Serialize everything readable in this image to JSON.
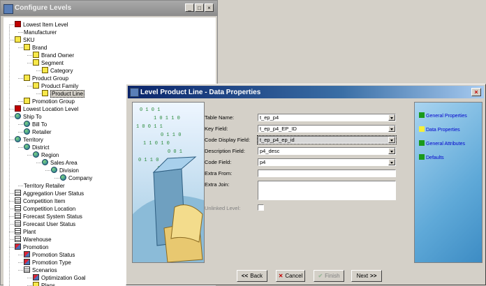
{
  "back_window": {
    "title": "Configure Levels",
    "tree": [
      {
        "label": "Lowest Item Level",
        "icon": "redx",
        "depth": 0
      },
      {
        "label": "Manufacturer",
        "icon": "none",
        "depth": 1
      },
      {
        "label": "SKU",
        "icon": "cube",
        "depth": 0
      },
      {
        "label": "Brand",
        "icon": "cube",
        "depth": 1
      },
      {
        "label": "Brand Owner",
        "icon": "cube",
        "depth": 2
      },
      {
        "label": "Segment",
        "icon": "cube",
        "depth": 2
      },
      {
        "label": "Category",
        "icon": "cube",
        "depth": 3
      },
      {
        "label": "Product Group",
        "icon": "cube",
        "depth": 1
      },
      {
        "label": "Product Family",
        "icon": "cube",
        "depth": 2
      },
      {
        "label": "Product Line",
        "icon": "cube",
        "depth": 3,
        "selected": true
      },
      {
        "label": "Promotion Group",
        "icon": "cube",
        "depth": 1
      },
      {
        "label": "Lowest Location Level",
        "icon": "redx",
        "depth": 0
      },
      {
        "label": "Ship To",
        "icon": "globe",
        "depth": 0
      },
      {
        "label": "Bill To",
        "icon": "globe",
        "depth": 1
      },
      {
        "label": "Retailer",
        "icon": "globe",
        "depth": 1
      },
      {
        "label": "Territory",
        "icon": "globe",
        "depth": 0
      },
      {
        "label": "District",
        "icon": "globe",
        "depth": 1
      },
      {
        "label": "Region",
        "icon": "globe",
        "depth": 2
      },
      {
        "label": "Sales Area",
        "icon": "globe",
        "depth": 3
      },
      {
        "label": "Division",
        "icon": "globe",
        "depth": 4
      },
      {
        "label": "Company",
        "icon": "globe",
        "depth": 5
      },
      {
        "label": "Territory Retailer",
        "icon": "none",
        "depth": 1
      },
      {
        "label": "Aggregation User Status",
        "icon": "table",
        "depth": 0
      },
      {
        "label": "Competition Item",
        "icon": "table",
        "depth": 0
      },
      {
        "label": "Competition Location",
        "icon": "table",
        "depth": 0
      },
      {
        "label": "Forecast System Status",
        "icon": "table",
        "depth": 0
      },
      {
        "label": "Forecast User Status",
        "icon": "table",
        "depth": 0
      },
      {
        "label": "Plant",
        "icon": "table",
        "depth": 0
      },
      {
        "label": "Warehouse",
        "icon": "table",
        "depth": 0
      },
      {
        "label": "Promotion",
        "icon": "promo",
        "depth": 0
      },
      {
        "label": "Promotion Status",
        "icon": "promo",
        "depth": 1
      },
      {
        "label": "Promotion Type",
        "icon": "promo",
        "depth": 1
      },
      {
        "label": "Scenarios",
        "icon": "table",
        "depth": 1
      },
      {
        "label": "Optimization Goal",
        "icon": "promo",
        "depth": 2
      },
      {
        "label": "Plans",
        "icon": "cube",
        "depth": 2
      }
    ]
  },
  "dialog": {
    "title": "Level Product Line - Data Properties",
    "fields": [
      {
        "label": "Table Name:",
        "value": "t_ep_p4",
        "type": "combo"
      },
      {
        "label": "Key Field:",
        "value": "t_ep_p4_EP_ID",
        "type": "combo"
      },
      {
        "label": "Code Display Field:",
        "value": "t_ep_p4_ep_id",
        "type": "combo"
      },
      {
        "label": "Description Field:",
        "value": "p4_desc",
        "type": "combo"
      },
      {
        "label": "Code Field:",
        "value": "p4",
        "type": "combo"
      },
      {
        "label": "Extra From:",
        "value": "",
        "type": "text"
      },
      {
        "label": "Extra Join:",
        "value": "",
        "type": "textarea"
      },
      {
        "label": "Unlinked Level:",
        "value": "",
        "type": "checkbox",
        "disabled": true
      }
    ],
    "nav": [
      {
        "label": "General Properties",
        "color": "#1a9a1a"
      },
      {
        "label": "Data Properties",
        "color": "#f5ef3a"
      },
      {
        "label": "General Attributes",
        "color": "#1a9a1a"
      },
      {
        "label": "Defaults",
        "color": "#1a9a1a"
      }
    ],
    "buttons": {
      "back": "Back",
      "cancel": "Cancel",
      "finish": "Finish",
      "next": "Next"
    }
  }
}
